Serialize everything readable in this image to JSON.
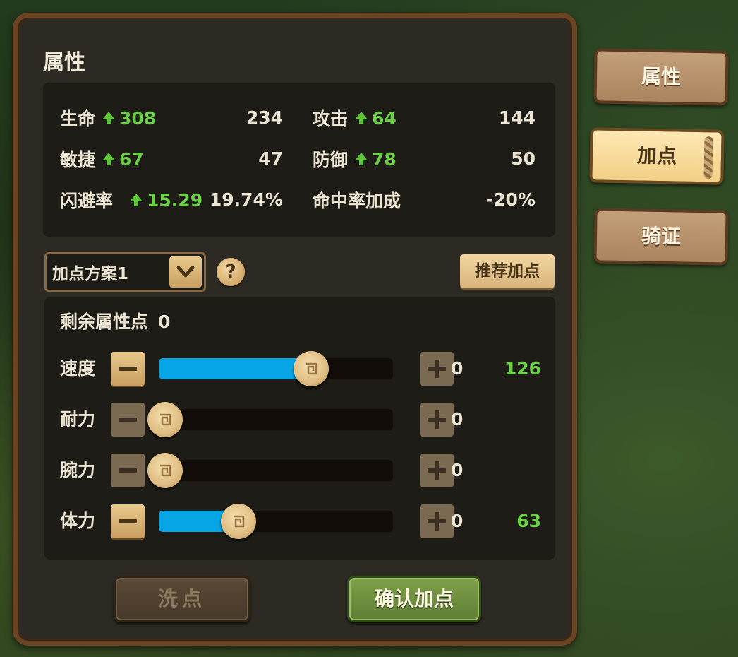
{
  "panel": {
    "title": "属性"
  },
  "stats": [
    {
      "name": "生命",
      "bonus": "308",
      "value": "234"
    },
    {
      "name": "攻击",
      "bonus": "64",
      "value": "144"
    },
    {
      "name": "敏捷",
      "bonus": "67",
      "value": "47"
    },
    {
      "name": "防御",
      "bonus": "78",
      "value": "50"
    },
    {
      "name": "闪避率",
      "bonus": "15.29",
      "value": "19.74%"
    },
    {
      "name": "命中率加成",
      "bonus": "",
      "value": "-20%"
    }
  ],
  "preset": {
    "selected": "加点方案1"
  },
  "help_label": "?",
  "recommend_label": "推荐加点",
  "remaining": {
    "label": "剩余属性点",
    "value": "0"
  },
  "attributes": [
    {
      "name": "速度",
      "points": "0",
      "total": "126",
      "fill_fraction": 0.65
    },
    {
      "name": "耐力",
      "points": "0",
      "total": "",
      "fill_fraction": 0
    },
    {
      "name": "腕力",
      "points": "0",
      "total": "",
      "fill_fraction": 0
    },
    {
      "name": "体力",
      "points": "0",
      "total": "63",
      "fill_fraction": 0.34
    }
  ],
  "buttons": {
    "reset": "洗点",
    "confirm": "确认加点"
  },
  "tabs": [
    {
      "label": "属性",
      "active": false
    },
    {
      "label": "加点",
      "active": true
    },
    {
      "label": "骑证",
      "active": false
    }
  ],
  "colors": {
    "bonus_green": "#6cd146",
    "bar_blue": "#05a5e6",
    "panel_border": "#6b4424"
  }
}
